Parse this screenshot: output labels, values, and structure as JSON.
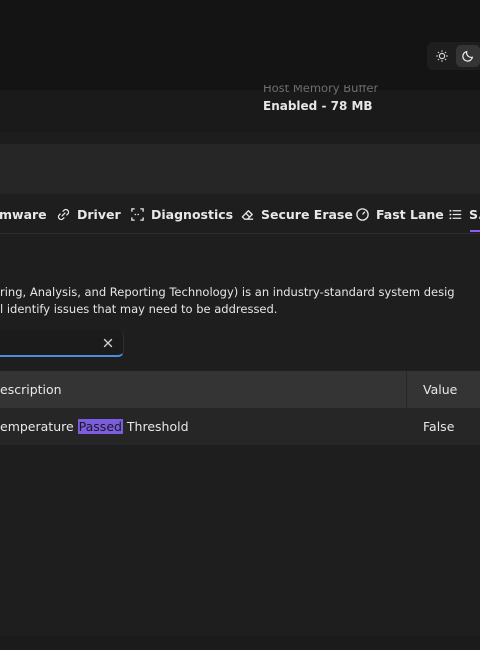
{
  "theme": {
    "light_icon": "sun-icon",
    "dark_icon": "moon-icon",
    "active": "dark"
  },
  "info": {
    "label": "Host Memory Buffer",
    "value": "Enabled - 78 MB"
  },
  "tabs": [
    {
      "label": "mware",
      "icon": "firmware-icon"
    },
    {
      "label": "Driver",
      "icon": "link-icon"
    },
    {
      "label": "Diagnostics",
      "icon": "scan-icon"
    },
    {
      "label": "Secure Erase",
      "icon": "eraser-icon"
    },
    {
      "label": "Fast Lane",
      "icon": "gauge-icon"
    },
    {
      "label": "S.",
      "icon": "list-icon",
      "active": true
    }
  ],
  "description": {
    "line1": "ring, Analysis, and Reporting Technology) is an industry-standard system desig",
    "line2": "l identify issues that may need to be addressed."
  },
  "search": {
    "value": "",
    "placeholder": ""
  },
  "table": {
    "columns": [
      "escription",
      "Value"
    ],
    "rows": [
      {
        "desc_before": "emperature ",
        "desc_match": "Passed",
        "desc_after": " Threshold",
        "value": "False"
      }
    ]
  },
  "colors": {
    "accent": "#8b5cf6",
    "highlight": "#7c5ce0",
    "focus": "#4a90d9"
  }
}
